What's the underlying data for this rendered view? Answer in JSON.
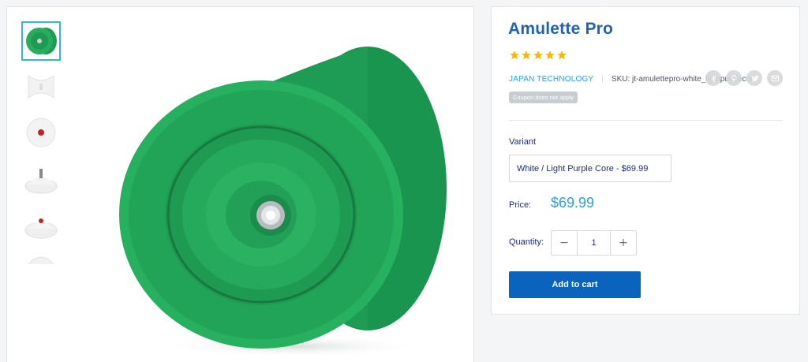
{
  "product": {
    "title": "Amulette Pro",
    "rating": 5,
    "vendor": "JAPAN TECHNOLOGY",
    "sku": "SKU: jt-amulettepro-white_lightpurplecore",
    "badge": "Coupon does not apply"
  },
  "variant": {
    "label": "Variant",
    "selected": "White / Light Purple Core - $69.99"
  },
  "price": {
    "label": "Price:",
    "value": "$69.99"
  },
  "quantity": {
    "label": "Quantity:",
    "value": "1",
    "minus": "−",
    "plus": "+"
  },
  "add_to_cart": "Add to cart",
  "share_icons": [
    "facebook-icon",
    "pinterest-icon",
    "twitter-icon",
    "email-icon"
  ],
  "colors": {
    "title": "#1e64b5",
    "accent": "#2aa3d9",
    "button": "#0a63bc",
    "star": "#f5b800",
    "yoyo_green": "#22a35a"
  }
}
